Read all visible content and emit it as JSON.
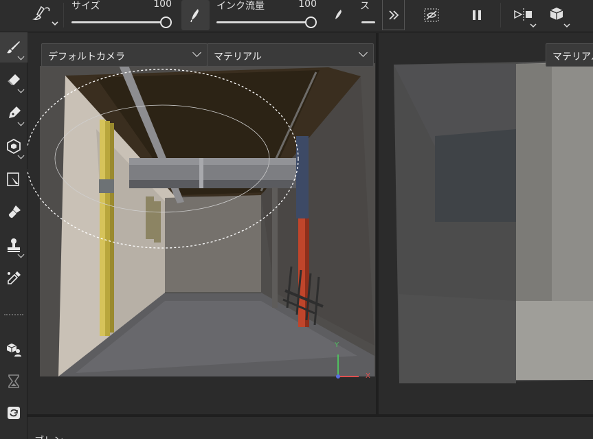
{
  "toolbar": {
    "size_label": "サイズ",
    "size_value": "100",
    "size_fraction": 1.0,
    "ink_flow_label": "インク流量",
    "ink_flow_value": "100",
    "ink_flow_fraction": 1.0,
    "third_label": "ス",
    "icons": [
      "brush-preset-icon",
      "pen-pressure-icon",
      "ink-pressure-icon",
      "expand-icon",
      "hide-selection-icon",
      "pause-icon",
      "symmetry-icon",
      "3d-cube-icon"
    ]
  },
  "left_tools": [
    "brush-icon",
    "eraser-icon",
    "pen-icon",
    "3d-object-icon",
    "select-transform-icon",
    "fill-icon",
    "stamp-icon",
    "eyedropper-icon",
    "3d-person-icon",
    "hourglass-icon",
    "refresh-icon"
  ],
  "viewport_left": {
    "camera_dropdown": "デフォルトカメラ",
    "material_dropdown": "マテリアル",
    "axis_y": "Y",
    "axis_x": "X"
  },
  "viewport_right": {
    "material_dropdown": "マテリアル"
  },
  "bottom_panel": {
    "label": "ブレン"
  },
  "colors": {
    "ui_dark": "#2d2d2d",
    "accent_axis_x": "#e05050",
    "accent_axis_y": "#50c060"
  }
}
